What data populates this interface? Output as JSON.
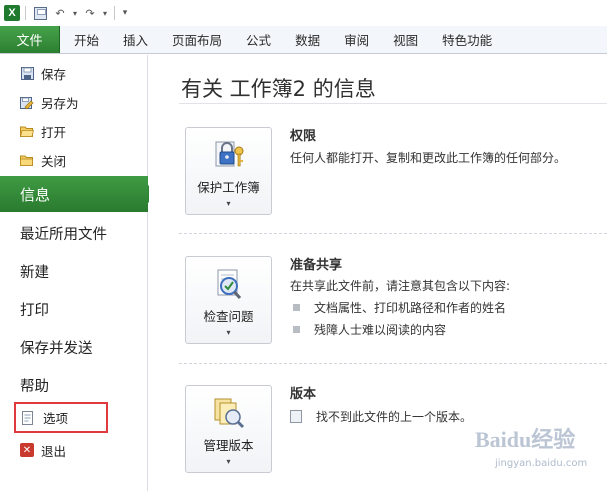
{
  "qat": {
    "logo": "X",
    "undo": "↶",
    "redo": "↷",
    "more": "▾"
  },
  "tabs": {
    "file": "文件",
    "items": [
      "开始",
      "插入",
      "页面布局",
      "公式",
      "数据",
      "审阅",
      "视图",
      "特色功能"
    ]
  },
  "nav": {
    "small_items": [
      {
        "label": "保存",
        "icon": "save-icon"
      },
      {
        "label": "另存为",
        "icon": "save-as-icon"
      },
      {
        "label": "打开",
        "icon": "open-folder-icon"
      },
      {
        "label": "关闭",
        "icon": "close-folder-icon"
      }
    ],
    "info": "信息",
    "large_items": [
      "最近所用文件",
      "新建",
      "打印",
      "保存并发送",
      "帮助"
    ],
    "options": "选项",
    "exit": "退出"
  },
  "main": {
    "title": "有关 工作簿2 的信息",
    "permissions": {
      "button": "保护工作簿",
      "heading": "权限",
      "text": "任何人都能打开、复制和更改此工作簿的任何部分。"
    },
    "share": {
      "button": "检查问题",
      "heading": "准备共享",
      "text": "在共享此文件前，请注意其包含以下内容:",
      "bullets": [
        "文档属性、打印机路径和作者的姓名",
        "残障人士难以阅读的内容"
      ]
    },
    "versions": {
      "button": "管理版本",
      "heading": "版本",
      "text": "找不到此文件的上一个版本。"
    },
    "dropdown_arrow": "▾"
  },
  "watermark": {
    "line1": "Baidu经验",
    "line2": "jingyan.baidu.com"
  },
  "colors": {
    "file_tab": "#2c7f31",
    "info_selected": "#2f8434",
    "highlight_box": "#e0393e"
  }
}
